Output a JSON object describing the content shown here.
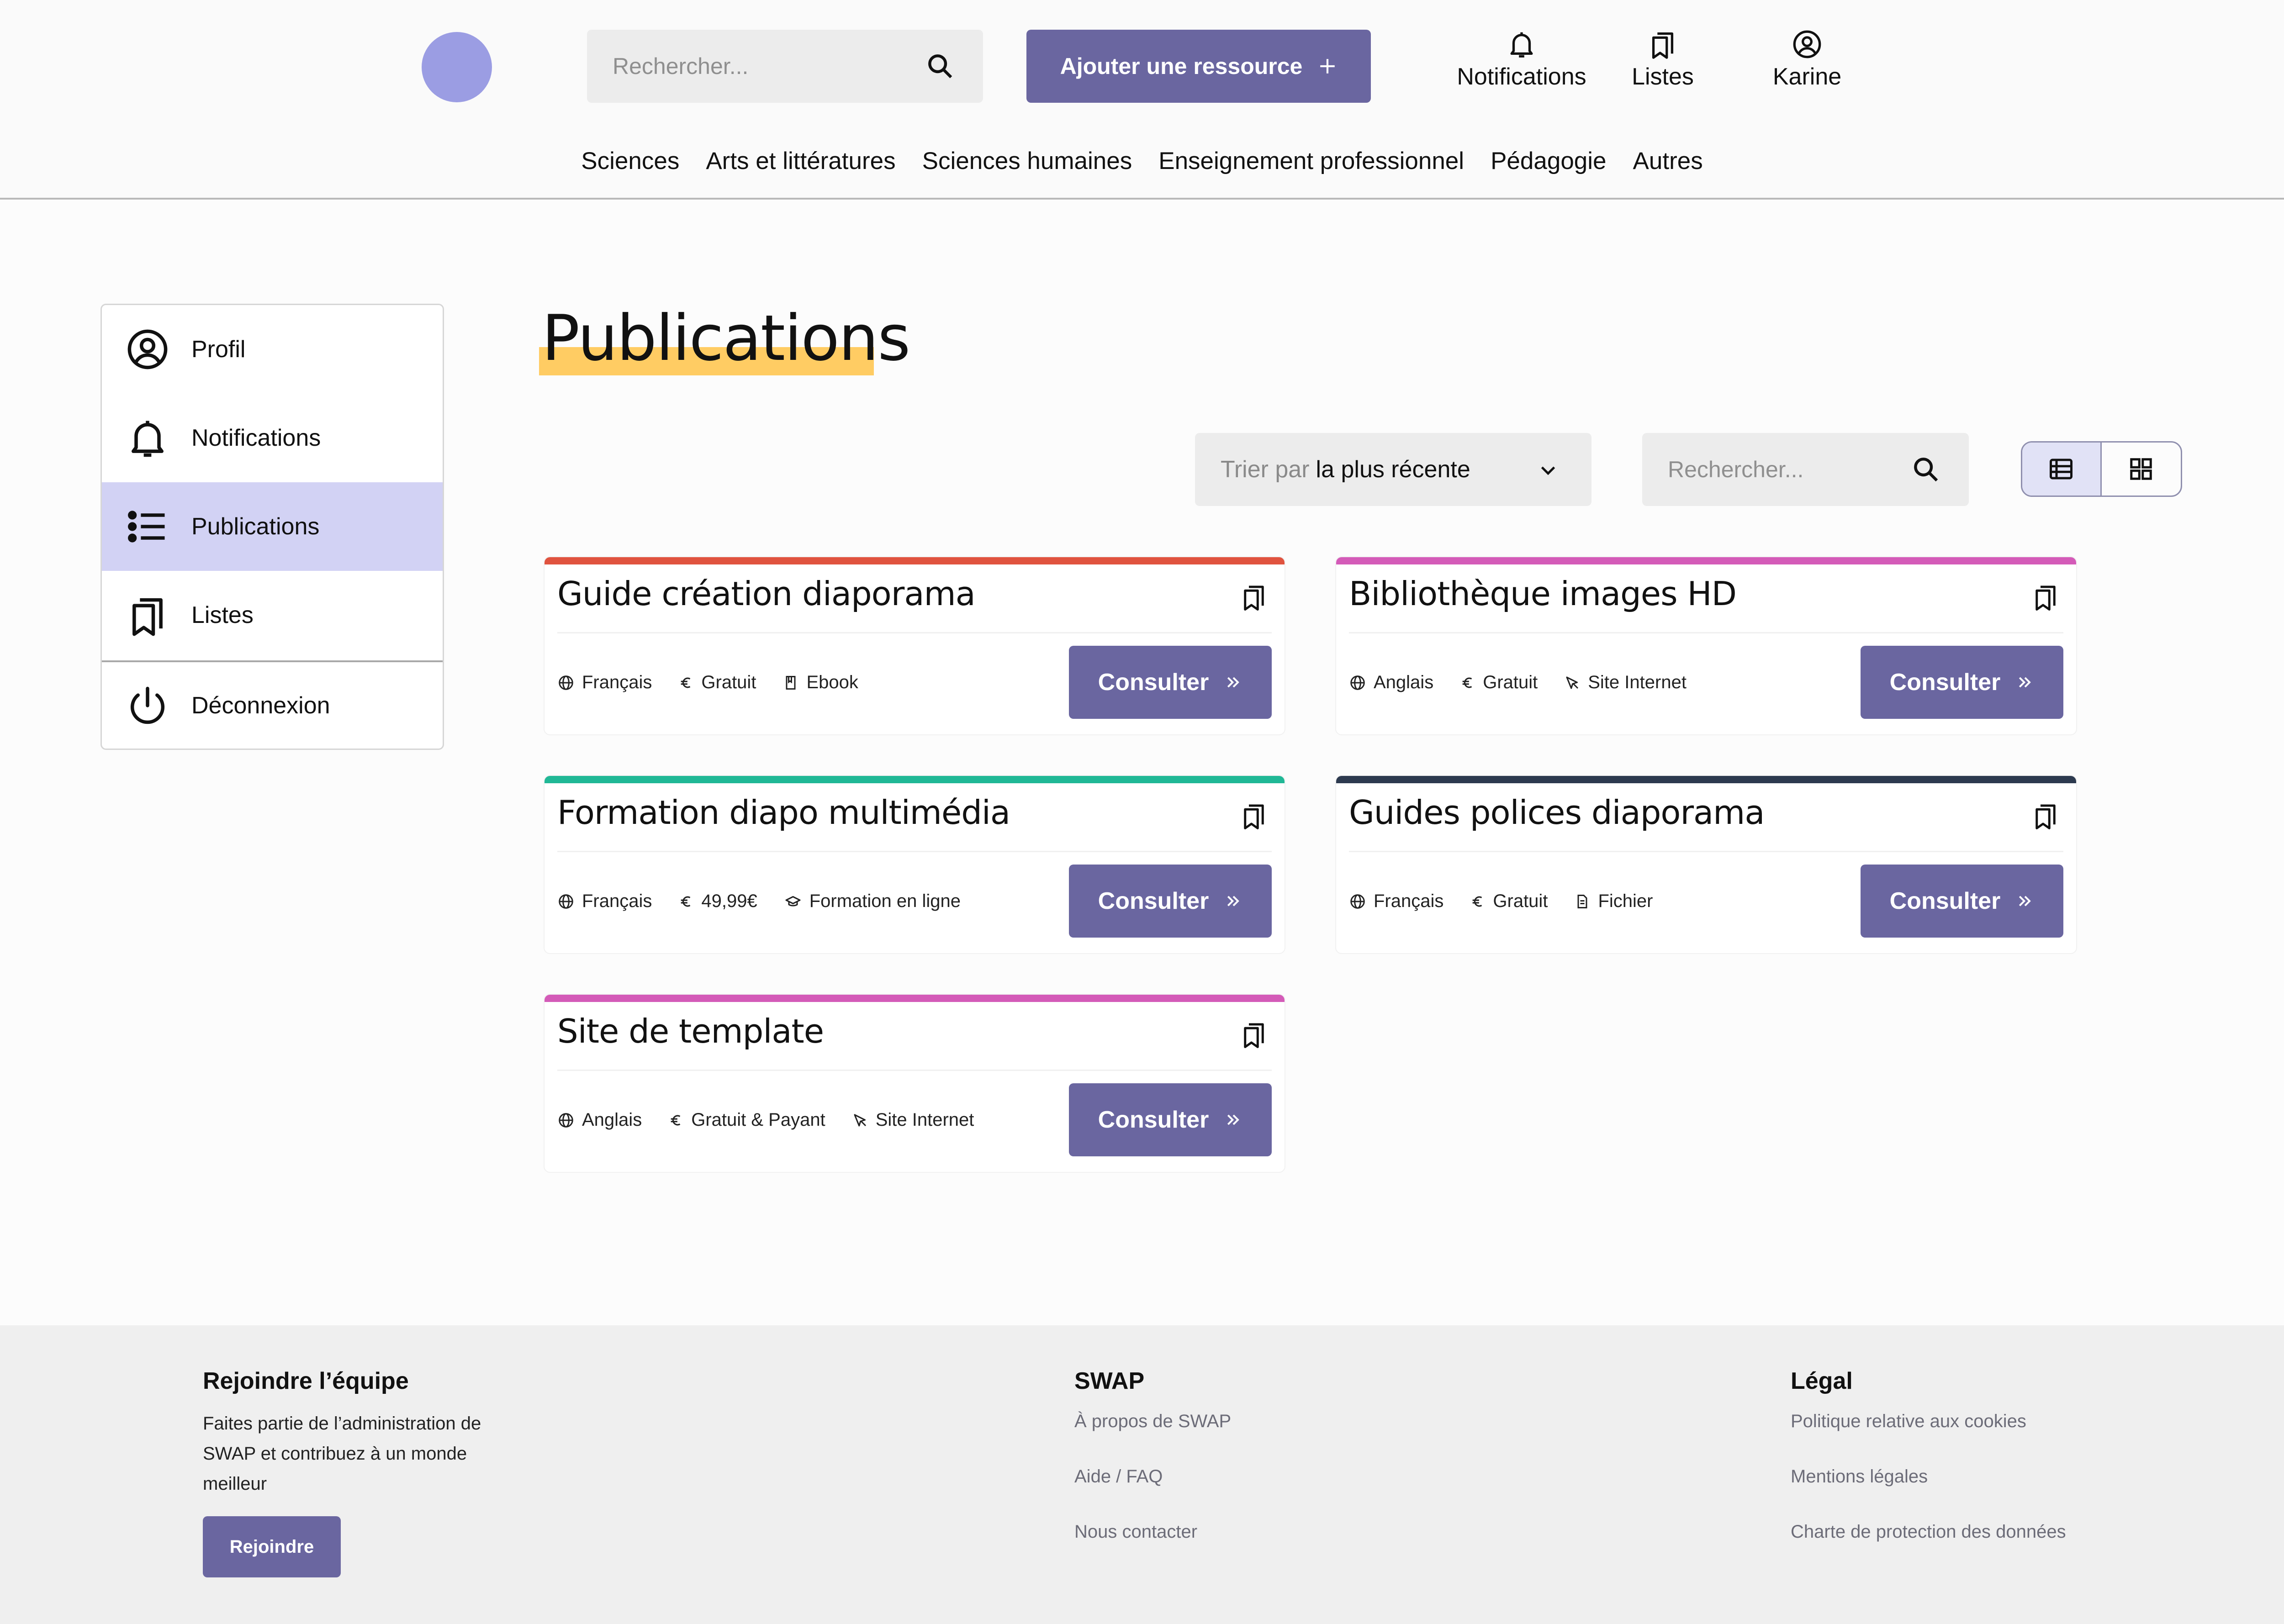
{
  "header": {
    "search_placeholder": "Rechercher...",
    "add_button_label": "Ajouter une ressource",
    "nav": [
      {
        "label": "Notifications",
        "icon": "bell-icon"
      },
      {
        "label": "Listes",
        "icon": "bookmarks-icon"
      },
      {
        "label": "Karine",
        "icon": "user-circle-icon"
      }
    ],
    "categories": [
      "Sciences",
      "Arts et littératures",
      "Sciences humaines",
      "Enseignement professionnel",
      "Pédagogie",
      "Autres"
    ]
  },
  "sidebar": {
    "items": [
      {
        "label": "Profil",
        "icon": "user-circle-icon",
        "active": false
      },
      {
        "label": "Notifications",
        "icon": "bell-icon",
        "active": false
      },
      {
        "label": "Publications",
        "icon": "list-icon",
        "active": true
      },
      {
        "label": "Listes",
        "icon": "bookmarks-icon",
        "active": false
      },
      {
        "label": "Déconnexion",
        "icon": "power-icon",
        "active": false
      }
    ]
  },
  "main": {
    "title": "Publications",
    "sort_prefix": "Trier par",
    "sort_value": "la plus récente",
    "search_placeholder": "Rechercher...",
    "view_modes": [
      "list",
      "grid"
    ],
    "active_view": "list",
    "consult_label": "Consulter",
    "cards": [
      {
        "title": "Guide création diaporama",
        "color": "#e0533f",
        "language": "Français",
        "price": "Gratuit",
        "type": "Ebook",
        "type_icon": "book-icon"
      },
      {
        "title": "Bibliothèque images HD",
        "color": "#d45bb8",
        "language": "Anglais",
        "price": "Gratuit",
        "type": "Site Internet",
        "type_icon": "cursor-icon"
      },
      {
        "title": "Formation diapo multimédia",
        "color": "#20b896",
        "language": "Français",
        "price": "49,99€",
        "type": "Formation en ligne",
        "type_icon": "graduation-cap-icon"
      },
      {
        "title": "Guides polices diaporama",
        "color": "#2d3a4f",
        "language": "Français",
        "price": "Gratuit",
        "type": "Fichier",
        "type_icon": "file-icon"
      },
      {
        "title": "Site de template",
        "color": "#d45bb8",
        "language": "Anglais",
        "price": "Gratuit & Payant",
        "type": "Site Internet",
        "type_icon": "cursor-icon"
      }
    ]
  },
  "footer": {
    "join": {
      "title": "Rejoindre l’équipe",
      "text": "Faites partie de l’administration de SWAP et contribuez à un monde meilleur",
      "button": "Rejoindre"
    },
    "swap": {
      "title": "SWAP",
      "links": [
        "À propos de SWAP",
        "Aide / FAQ",
        "Nous contacter"
      ]
    },
    "legal": {
      "title": "Légal",
      "links": [
        "Politique relative aux cookies",
        "Mentions légales",
        "Charte de protection des données"
      ]
    }
  },
  "colors": {
    "accent": "#6a66a0",
    "highlight": "#ffcc63",
    "active_sidebar": "#d2d2f4",
    "logo": "#9b9de3"
  }
}
